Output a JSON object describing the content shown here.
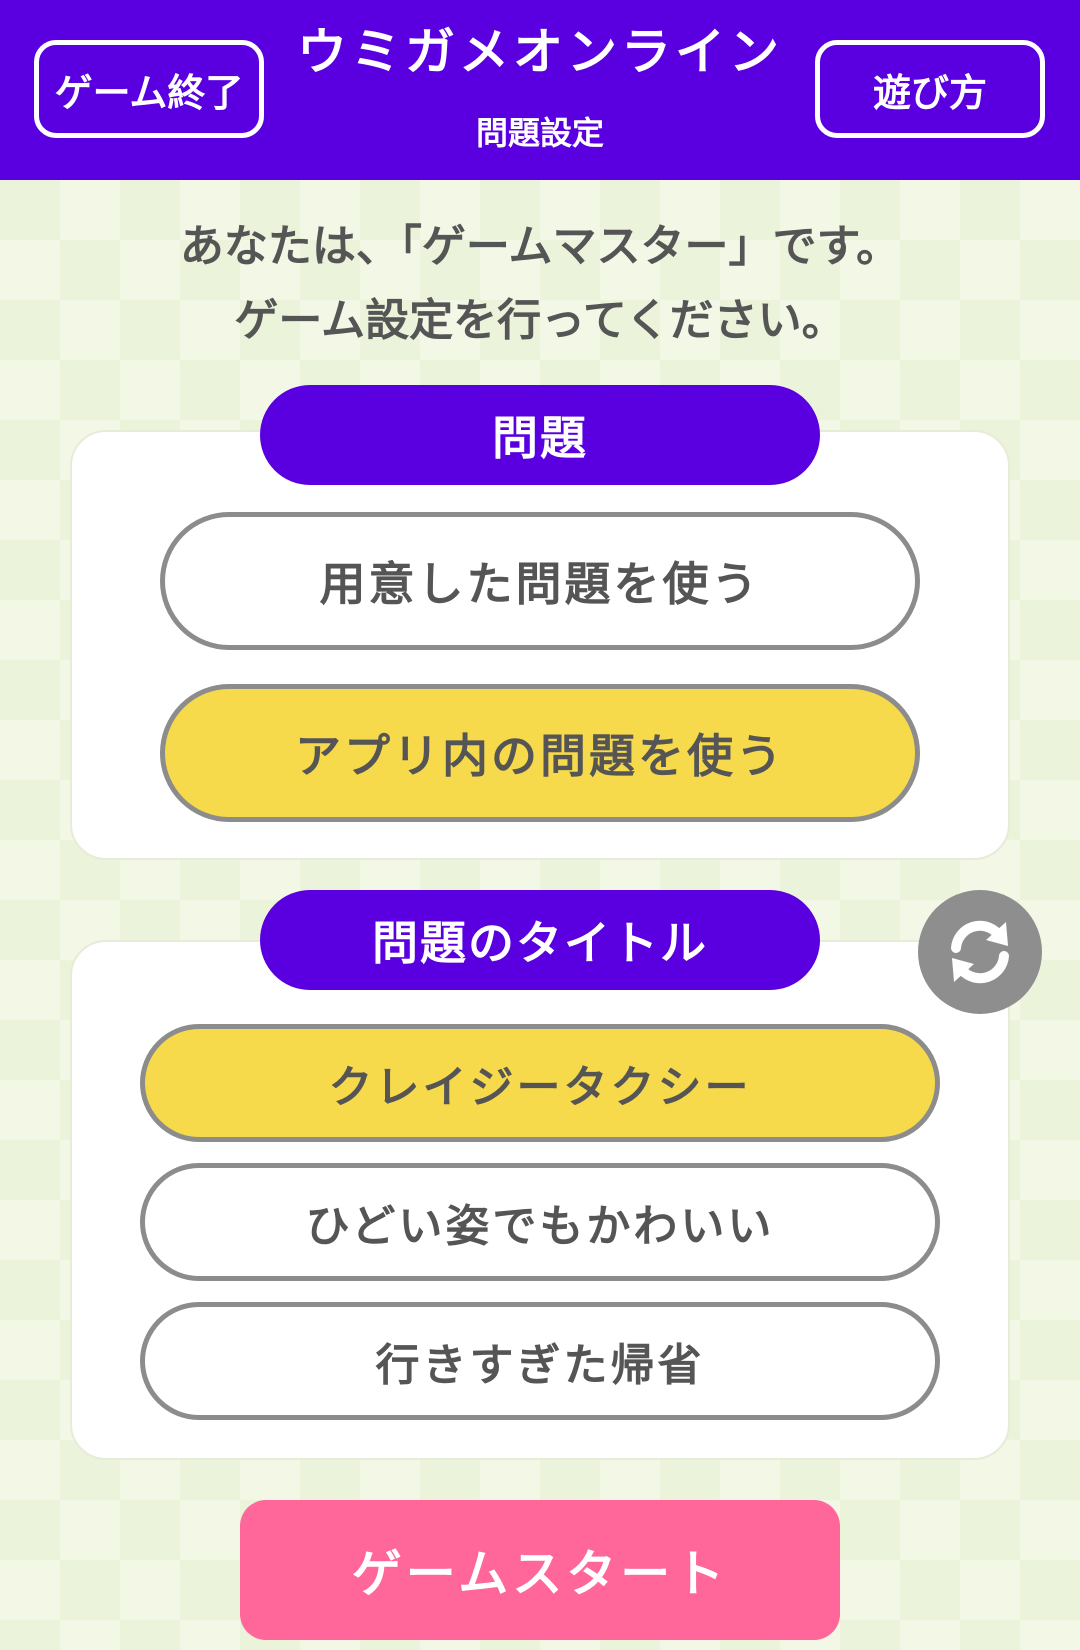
{
  "header": {
    "exit_label": "ゲーム終了",
    "app_title": "ウミガメオンライン",
    "subtitle": "問題設定",
    "howto_label": "遊び方"
  },
  "instructions": {
    "line1": "あなたは、「ゲームマスター」です。",
    "line2": "ゲーム設定を行ってください。"
  },
  "problem_section": {
    "heading": "問題",
    "options": [
      {
        "label": "用意した問題を使う",
        "selected": false
      },
      {
        "label": "アプリ内の問題を使う",
        "selected": true
      }
    ]
  },
  "title_section": {
    "heading": "問題のタイトル",
    "refresh_icon": "refresh-icon",
    "options": [
      {
        "label": "クレイジータクシー",
        "selected": true
      },
      {
        "label": "ひどい姿でもかわいい",
        "selected": false
      },
      {
        "label": "行きすぎた帰省",
        "selected": false
      }
    ]
  },
  "start_label": "ゲームスタート",
  "colors": {
    "header": "#5a00e0",
    "selected": "#f7d94c",
    "start": "#ff6699",
    "background": "#f2f7e6"
  }
}
